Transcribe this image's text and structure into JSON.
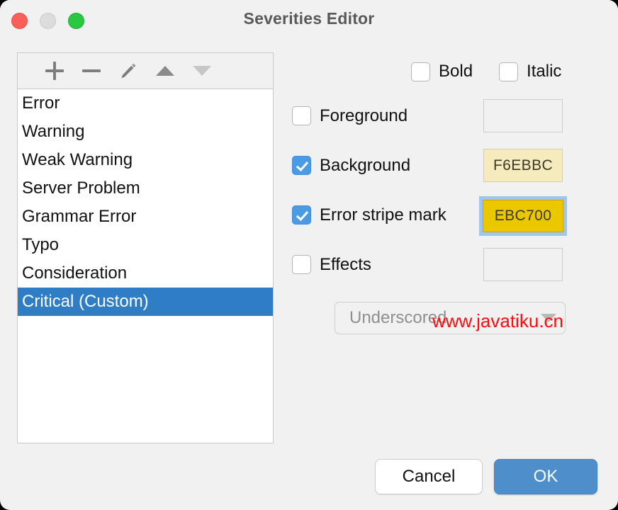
{
  "window": {
    "title": "Severities Editor",
    "traffic_lights": {
      "close": "close-button",
      "minimize": "minimize-button",
      "zoom": "zoom-button"
    }
  },
  "toolbar": {
    "add_label": "+",
    "remove_label": "−",
    "edit_label": "edit",
    "move_up_label": "move up",
    "move_down_label": "move down"
  },
  "severities_list": {
    "items": [
      {
        "label": "Error",
        "selected": false
      },
      {
        "label": "Warning",
        "selected": false
      },
      {
        "label": "Weak Warning",
        "selected": false
      },
      {
        "label": "Server Problem",
        "selected": false
      },
      {
        "label": "Grammar Error",
        "selected": false
      },
      {
        "label": "Typo",
        "selected": false
      },
      {
        "label": "Consideration",
        "selected": false
      },
      {
        "label": "Critical (Custom)",
        "selected": true
      }
    ]
  },
  "font_style": {
    "bold": {
      "label": "Bold",
      "checked": false
    },
    "italic": {
      "label": "Italic",
      "checked": false
    }
  },
  "options": {
    "foreground": {
      "label": "Foreground",
      "checked": false,
      "color_value": "",
      "color_hex": ""
    },
    "background": {
      "label": "Background",
      "checked": true,
      "color_value": "F6EBBC",
      "color_hex": "#F6EBBC"
    },
    "error_stripe_mark": {
      "label": "Error stripe mark",
      "checked": true,
      "color_value": "EBC700",
      "color_hex": "#EBC700",
      "focused": true
    },
    "effects": {
      "label": "Effects",
      "checked": false,
      "color_value": "",
      "color_hex": ""
    }
  },
  "effects_select": {
    "value": "Underscored",
    "enabled": false
  },
  "watermark": {
    "text": "www.javatiku.cn",
    "color": "#FD0C0C"
  },
  "footer": {
    "cancel_label": "Cancel",
    "ok_label": "OK"
  },
  "colors": {
    "accent": "#2F7DC4",
    "checkbox_checked": "#4A9AE4",
    "primary_button": "#4E8ECB",
    "window_background": "#F1F1F1"
  }
}
